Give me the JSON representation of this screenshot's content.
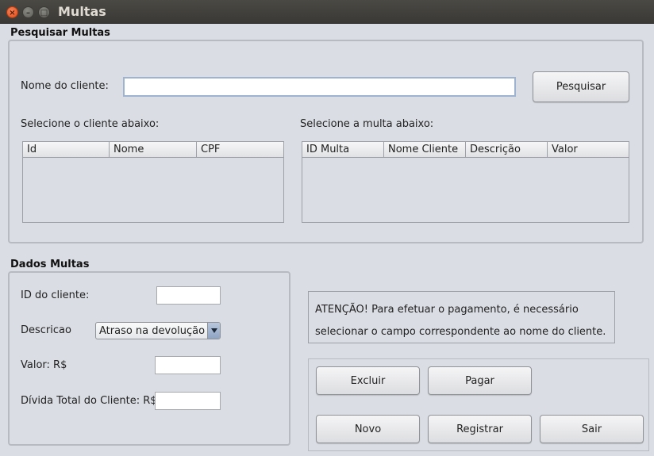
{
  "window": {
    "title": "Multas",
    "close_glyph": "×",
    "min_glyph": "–",
    "max_glyph": "□"
  },
  "pesquisar": {
    "section_title": "Pesquisar Multas",
    "nome_label": "Nome do cliente:",
    "nome_value": "",
    "pesquisar_button": "Pesquisar",
    "clientes_label": "Selecione o cliente abaixo:",
    "multas_label": "Selecione a multa abaixo:",
    "clientes_columns": [
      "Id",
      "Nome",
      "CPF"
    ],
    "multas_columns": [
      "ID Multa",
      "Nome Cliente",
      "Descrição",
      "Valor"
    ]
  },
  "dados": {
    "section_title": "Dados Multas",
    "id_label": "ID do cliente:",
    "id_value": "",
    "descricao_label": "Descricao",
    "descricao_selected": "Atraso na devolução",
    "valor_label": "Valor: R$",
    "valor_value": "",
    "divida_label": "Dívida Total do Cliente: R$",
    "divida_value": ""
  },
  "notice": {
    "line1": "ATENÇÃO! Para efetuar o pagamento, é necessário",
    "line2": "selecionar o campo correspondente ao nome do cliente."
  },
  "actions": {
    "excluir": "Excluir",
    "pagar": "Pagar",
    "novo": "Novo",
    "registrar": "Registrar",
    "sair": "Sair"
  }
}
